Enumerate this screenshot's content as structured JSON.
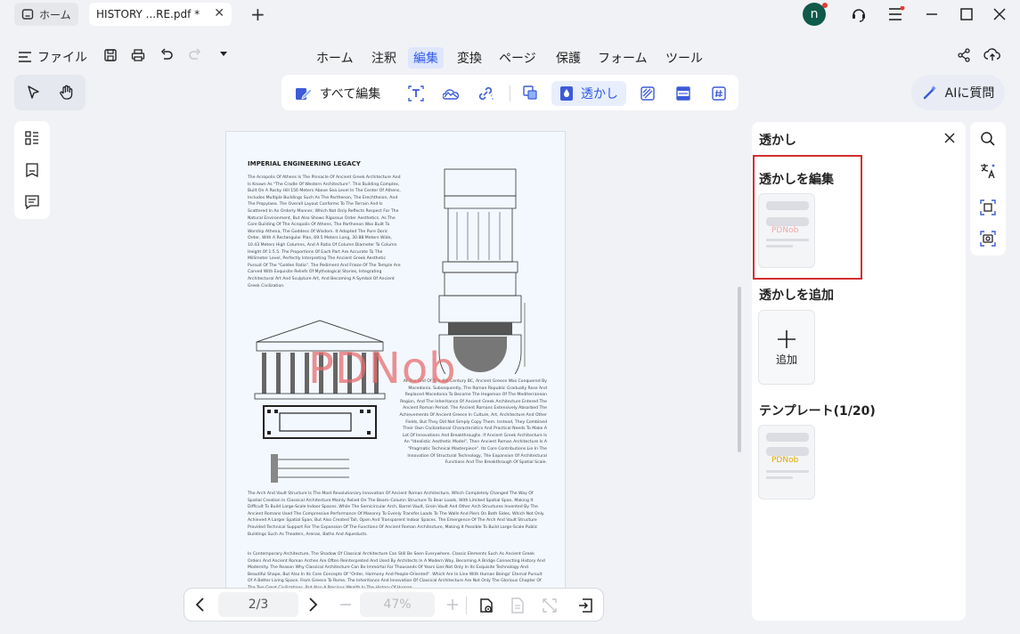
{
  "tabs": {
    "home": "ホーム",
    "doc": "HISTORY ...RE.pdf *",
    "close": "✕",
    "new": "+"
  },
  "avatar": "n",
  "file_menu": "ファイル",
  "menu": [
    "ホーム",
    "注釈",
    "編集",
    "変換",
    "ページ",
    "保護",
    "フォーム",
    "ツール"
  ],
  "tools": {
    "edit_all": "すべて編集",
    "watermark": "透かし"
  },
  "ai": "AIに質問",
  "doc": {
    "title": "IMPERIAL ENGINEERING LEGACY",
    "p1": "The Acropolis Of Athens Is The Pinnacle Of Ancient Greek Architecture And Is Known As \"The Cradle Of Western Architecture\". This Building Complex, Built On A Rocky Hill 156 Meters Above Sea Level In The Center Of Athens, Includes Multiple Buildings Such As The Parthenon, The Erechtheion, And The Propylaea. The Overall Layout Conforms To The Terrain And Is Scattered In An Orderly Manner, Which Not Only Reflects Respect For The Natural Environment, But Also Shows Rigorous Order Aesthetics. As The Core Building Of The Acropolis Of Athens, The Parthenon Was Built To Worship Athena, The Goddess Of Wisdom. It Adopted The Pure Doric Order, With A Rectangular Plan, 69.5 Meters Long, 30.88 Meters Wide, 10.43 Meters High Columns, And A Ratio Of Column Diameter To Column Height Of 1:5.5. The Proportions Of Each Part Are Accurate To The Millimeter Level, Perfectly Interpreting The Ancient Greek Aesthetic Pursuit Of The \"Golden Ratio\". The Pediment And Frieze Of The Temple Are Carved With Exquisite Reliefs Of Mythological Stories, Integrating Architectural Art And Sculpture Art, And Becoming A Symbol Of Ancient Greek Civilization.",
    "p2": "At The End Of The 4th Century BC, Ancient Greece Was Conquered By Macedonia. Subsequently, The Roman Republic Gradually Rose And Replaced Macedonia To Become The Hegemon Of The Mediterranean Region, And The Inheritance Of Ancient Greek Architecture Entered The Ancient Roman Period. The Ancient Romans Extensively Absorbed The Achievements Of Ancient Greece In Culture, Art, Architecture And Other Fields, But They Did Not Simply Copy Them. Instead, They Combined Their Own Civilizational Characteristics And Practical Needs To Make A Lot Of Innovations And Breakthroughs. If Ancient Greek Architecture Is An \"Idealistic Aesthetic Model\", Then Ancient Roman Architecture Is A \"Pragmatic Technical Masterpiece\". Its Core Contributions Lie In The Innovation Of Structural Technology, The Expansion Of Architectural Functions And The Breakthrough Of Spatial Scale.",
    "p3": "The Arch And Vault Structure Is The Most Revolutionary Innovation Of Ancient Roman Architecture, Which Completely Changed The Way Of Spatial Creation In Classical Architecture Mainly Relied On The Beam–Column Structure To Bear Loads, With Limited Spatial Span, Making It Difficult To Build Large-Scale Indoor Spaces. While The Semicircular Arch, Barrel Vault, Groin Vault And Other Arch Structures Invented By The Ancient Romans Used The Compressive Performance Of Masonry To Evenly Transfer Loads To The Walls And Piers On Both Sides, Which Not Only Achieved A Larger Spatial Span, But Also Created Tall, Open And Transparent Indoor Spaces. The Emergence Of The Arch And Vault Structure Provided Technical Support For The Expansion Of The Functions Of Ancient Roman Architecture, Making It Possible To Build Large-Scale Public Buildings Such As Theaters, Arenas, Baths And Aqueducts.",
    "p4": "In Contemporary Architecture, The Shadow Of Classical Architecture Can Still Be Seen Everywhere. Classic Elements Such As Ancient Greek Orders And Ancient Roman Arches Are Often Reinterpreted And Used By Architects In A Modern Way, Becoming A Bridge Connecting History And Modernity. The Reason Why Classical Architecture Can Be Immortal For Thousands Of Years Lies Not Only In Its Exquisite Technology And Beautiful Shape, But Also In Its Core Concepts Of \"Order, Harmony And People-Oriented\". Which Are In Line With Human Beings' Eternal Pursuit Of A Better Living Space. From Greece To Rome, The Inheritance And Innovation Of Classical Architecture Are Not Only The Glorious Chapter Of The Two Great Civilizations, But Also A Precious Wealth In The History Of Human",
    "watermark": "PDNob"
  },
  "pager": {
    "page": "2/3",
    "zoom": "47%"
  },
  "panel": {
    "title": "透かし",
    "edit_section": "透かしを編集",
    "add_section": "透かしを追加",
    "add_label": "追加",
    "template_section": "テンプレート(1/20)",
    "thumb_text": "PDNob",
    "template_text": "PDNob"
  },
  "colors": {
    "accent": "#2f5bea",
    "highlight_border": "#d32f2f",
    "watermark": "#e66e6e",
    "template_watermark": "#e0a800"
  }
}
